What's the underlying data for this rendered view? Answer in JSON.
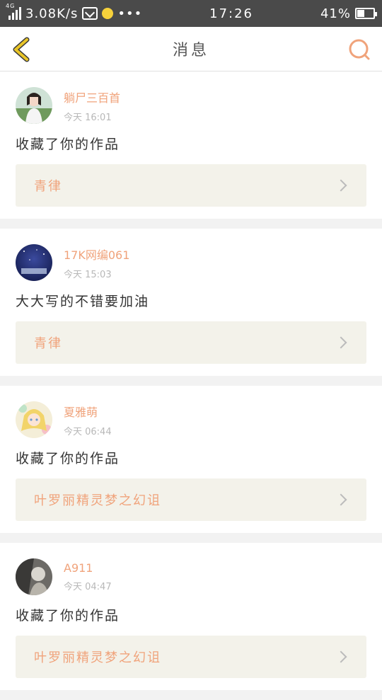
{
  "status_bar": {
    "network_type": "4G",
    "speed": "3.08K/s",
    "more": "•••",
    "time": "17:26",
    "battery_percent": "41%",
    "battery_level": 0.41
  },
  "header": {
    "title": "消息"
  },
  "colors": {
    "accent": "#f0a37b",
    "back": "#e9c528",
    "status_bar_bg": "#4a4a4a"
  },
  "messages": [
    {
      "username": "躺尸三百首",
      "time": "今天 16:01",
      "comment": "收藏了你的作品",
      "work_title": "青律"
    },
    {
      "username": "17K网编061",
      "time": "今天 15:03",
      "comment": "大大写的不错要加油",
      "work_title": "青律"
    },
    {
      "username": "夏雅萌",
      "time": "今天 06:44",
      "comment": "收藏了你的作品",
      "work_title": "叶罗丽精灵梦之幻诅"
    },
    {
      "username": "A911",
      "time": "今天 04:47",
      "comment": "收藏了你的作品",
      "work_title": "叶罗丽精灵梦之幻诅"
    }
  ]
}
